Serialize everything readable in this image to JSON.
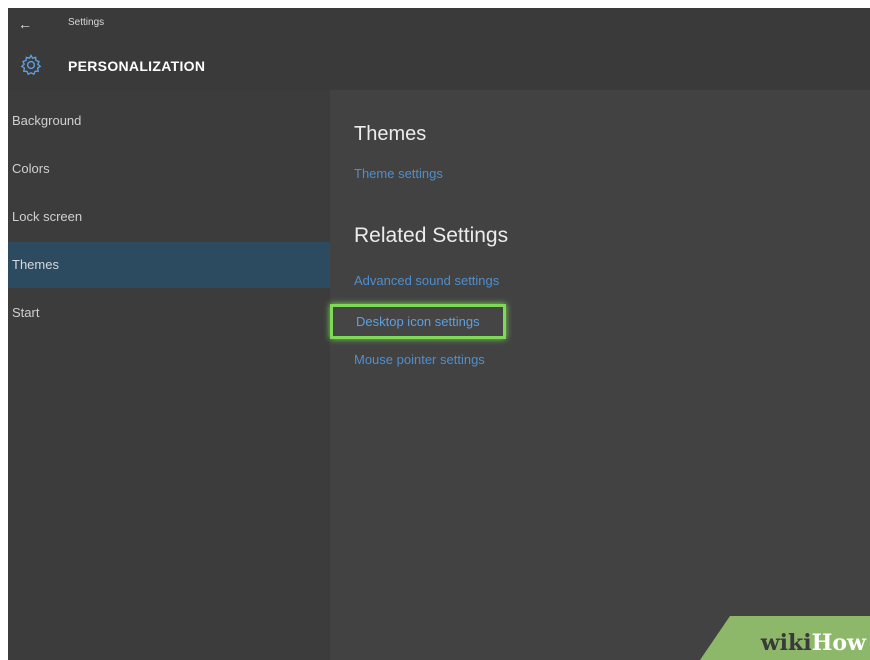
{
  "titlebar": {
    "back_glyph": "←",
    "app_title": "Settings",
    "section_icon": "gear-icon",
    "section_title": "PERSONALIZATION"
  },
  "sidebar": {
    "items": [
      {
        "label": "Background",
        "active": false
      },
      {
        "label": "Colors",
        "active": false
      },
      {
        "label": "Lock screen",
        "active": false
      },
      {
        "label": "Themes",
        "active": true
      },
      {
        "label": "Start",
        "active": false
      }
    ]
  },
  "content": {
    "themes_heading": "Themes",
    "theme_settings_link": "Theme settings",
    "related_heading": "Related Settings",
    "related_links": [
      "Advanced sound settings",
      "Desktop icon settings",
      "Mouse pointer settings"
    ]
  },
  "watermark": {
    "part1": "wiki",
    "part2": "How"
  },
  "colors": {
    "active_item": "#2c4a60",
    "link": "#4f8fce",
    "highlight_border": "#7ed957"
  }
}
